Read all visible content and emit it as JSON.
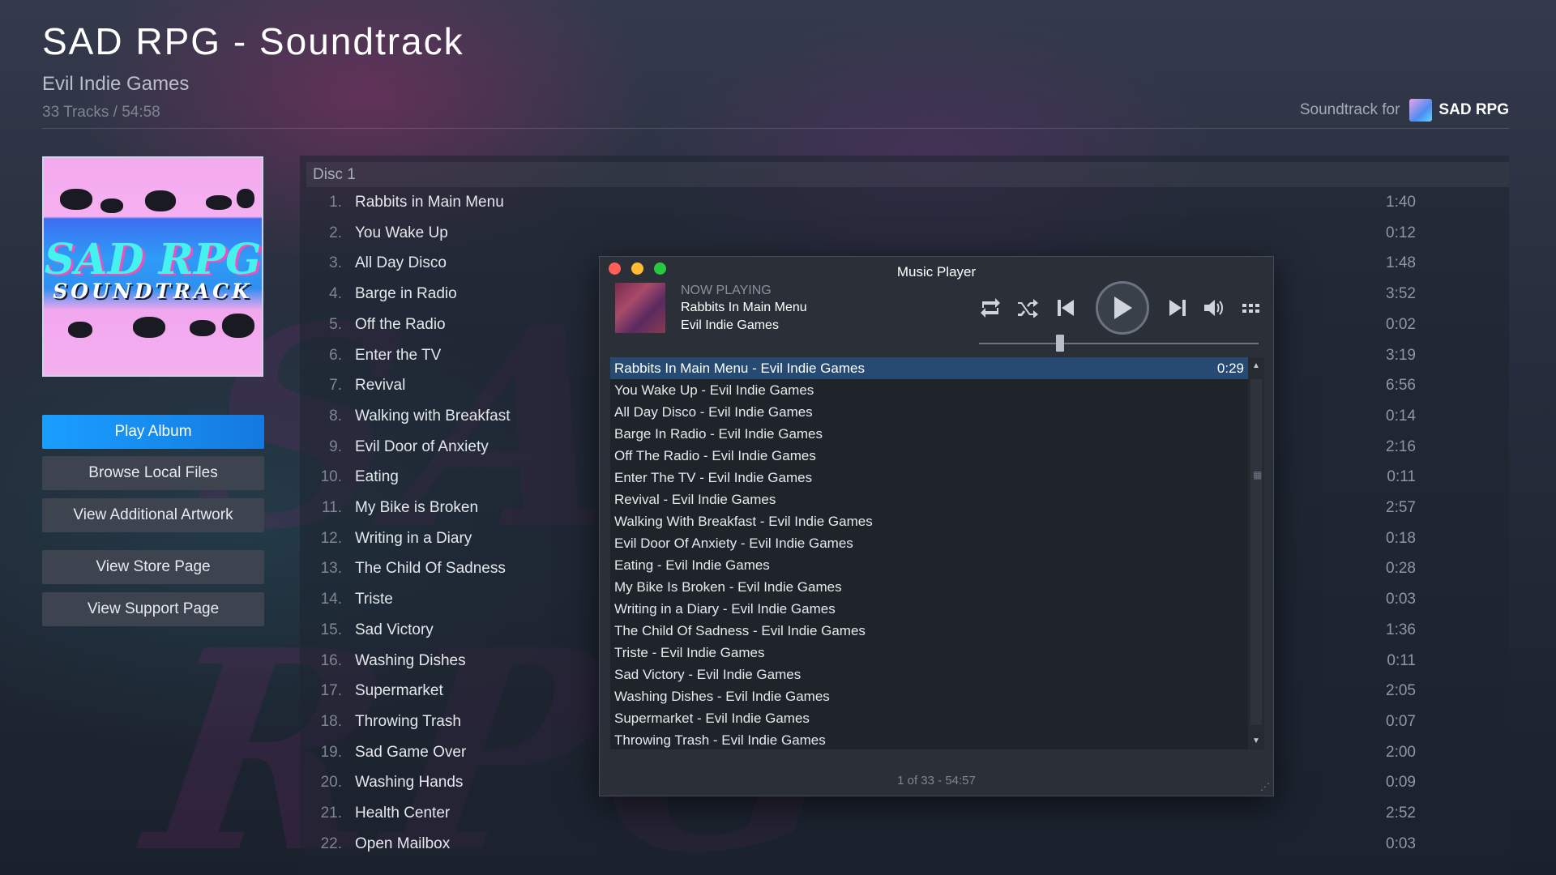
{
  "header": {
    "title": "SAD RPG - Soundtrack",
    "developer": "Evil Indie Games",
    "meta": "33 Tracks / 54:58",
    "soundtrack_for_label": "Soundtrack for",
    "soundtrack_for_game": "SAD RPG"
  },
  "album_art": {
    "title": "SAD RPG",
    "subtitle": "SOUNDTRACK"
  },
  "buttons": {
    "play_album": "Play Album",
    "browse_local_files": "Browse Local Files",
    "view_additional_artwork": "View Additional Artwork",
    "view_store_page": "View Store Page",
    "view_support_page": "View Support Page"
  },
  "tracklist": {
    "disc_label": "Disc 1",
    "tracks": [
      {
        "num": "1.",
        "name": "Rabbits in Main Menu",
        "time": "1:40"
      },
      {
        "num": "2.",
        "name": "You Wake Up",
        "time": "0:12"
      },
      {
        "num": "3.",
        "name": "All Day Disco",
        "time": "1:48"
      },
      {
        "num": "4.",
        "name": "Barge in Radio",
        "time": "3:52"
      },
      {
        "num": "5.",
        "name": "Off the Radio",
        "time": "0:02"
      },
      {
        "num": "6.",
        "name": "Enter the TV",
        "time": "3:19"
      },
      {
        "num": "7.",
        "name": "Revival",
        "time": "6:56"
      },
      {
        "num": "8.",
        "name": "Walking with Breakfast",
        "time": "0:14"
      },
      {
        "num": "9.",
        "name": "Evil Door of Anxiety",
        "time": "2:16"
      },
      {
        "num": "10.",
        "name": "Eating",
        "time": "0:11"
      },
      {
        "num": "11.",
        "name": "My Bike is Broken",
        "time": "2:57"
      },
      {
        "num": "12.",
        "name": "Writing in a Diary",
        "time": "0:18"
      },
      {
        "num": "13.",
        "name": "The Child Of Sadness",
        "time": "0:28"
      },
      {
        "num": "14.",
        "name": "Triste",
        "time": "0:03"
      },
      {
        "num": "15.",
        "name": "Sad Victory",
        "time": "1:36"
      },
      {
        "num": "16.",
        "name": "Washing Dishes",
        "time": "0:11"
      },
      {
        "num": "17.",
        "name": "Supermarket",
        "time": "2:05"
      },
      {
        "num": "18.",
        "name": "Throwing Trash",
        "time": "0:07"
      },
      {
        "num": "19.",
        "name": "Sad Game Over",
        "time": "2:00"
      },
      {
        "num": "20.",
        "name": "Washing Hands",
        "time": "0:09"
      },
      {
        "num": "21.",
        "name": "Health Center",
        "time": "2:52"
      },
      {
        "num": "22.",
        "name": "Open Mailbox",
        "time": "0:03"
      }
    ]
  },
  "player": {
    "window_title": "Music Player",
    "now_playing_label": "NOW PLAYING",
    "song": "Rabbits In Main Menu",
    "artist": "Evil Indie Games",
    "controls": [
      "repeat-icon",
      "shuffle-icon",
      "previous-icon",
      "play-icon",
      "next-icon",
      "volume-icon",
      "playlist-grid-icon"
    ],
    "seek_fraction": 0.29,
    "playlist": [
      {
        "title": "Rabbits In Main Menu - Evil Indie Games",
        "duration": "0:29"
      },
      {
        "title": "You Wake Up - Evil Indie Games"
      },
      {
        "title": "All Day Disco - Evil Indie Games"
      },
      {
        "title": "Barge In Radio - Evil Indie Games"
      },
      {
        "title": "Off The Radio - Evil Indie Games"
      },
      {
        "title": "Enter The TV - Evil Indie Games"
      },
      {
        "title": "Revival - Evil Indie Games"
      },
      {
        "title": "Walking With Breakfast - Evil Indie Games"
      },
      {
        "title": "Evil Door Of Anxiety - Evil Indie Games"
      },
      {
        "title": "Eating - Evil Indie Games"
      },
      {
        "title": "My Bike Is Broken - Evil Indie Games"
      },
      {
        "title": "Writing in a Diary - Evil Indie Games"
      },
      {
        "title": "The Child Of Sadness - Evil Indie Games"
      },
      {
        "title": "Triste - Evil Indie Games"
      },
      {
        "title": "Sad Victory - Evil Indie Games"
      },
      {
        "title": "Washing Dishes - Evil Indie Games"
      },
      {
        "title": "Supermarket - Evil Indie Games"
      },
      {
        "title": "Throwing Trash - Evil Indie Games"
      }
    ],
    "status": "1 of 33 - 54:57"
  },
  "colors": {
    "primary_button": "#1a9fff",
    "selected_row": "#264a72",
    "background": "#1c2431"
  }
}
